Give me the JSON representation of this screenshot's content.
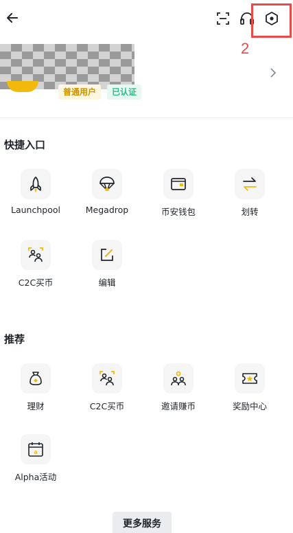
{
  "header": {
    "back_icon": "arrow-left-icon",
    "scan_icon": "scan-icon",
    "support_icon": "headset-icon",
    "settings_icon": "settings-hexagon-icon",
    "annotation_number": "2",
    "annotation_color": "#e84a4a"
  },
  "profile": {
    "badge_user": "普通用户",
    "badge_verified": "已认证",
    "accent": "#f0b90b"
  },
  "quick_access": {
    "title": "快捷入口",
    "items": [
      {
        "label": "Launchpool",
        "icon": "rocket-icon"
      },
      {
        "label": "Megadrop",
        "icon": "parachute-icon"
      },
      {
        "label": "币安钱包",
        "icon": "wallet-icon"
      },
      {
        "label": "划转",
        "icon": "transfer-icon"
      },
      {
        "label": "C2C买币",
        "icon": "c2c-users-icon"
      },
      {
        "label": "编辑",
        "icon": "edit-icon"
      }
    ]
  },
  "recommend": {
    "title": "推荐",
    "items": [
      {
        "label": "理财",
        "icon": "money-bag-icon"
      },
      {
        "label": "C2C买币",
        "icon": "c2c-users-icon"
      },
      {
        "label": "邀请赚币",
        "icon": "invite-users-icon"
      },
      {
        "label": "奖励中心",
        "icon": "reward-ticket-icon"
      },
      {
        "label": "Alpha活动",
        "icon": "alpha-calendar-icon"
      }
    ]
  },
  "more_services": "更多服务"
}
